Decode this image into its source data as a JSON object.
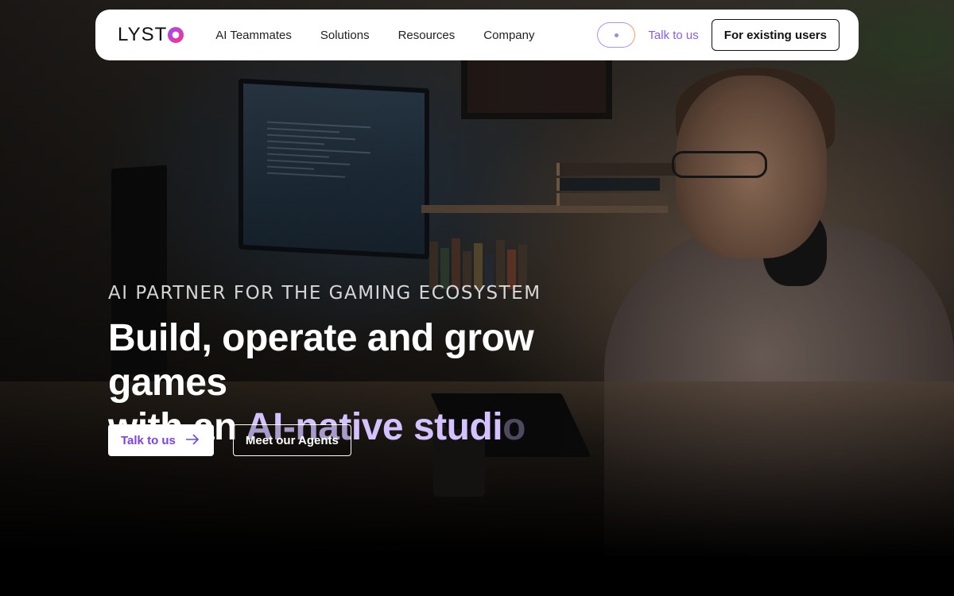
{
  "brand": {
    "logo_text": "LYST",
    "logo_mark": "o"
  },
  "nav": {
    "links": [
      "AI Teammates",
      "Solutions",
      "Resources",
      "Company"
    ],
    "talk_label": "Talk to us",
    "existing_users_label": "For existing users"
  },
  "hero": {
    "eyebrow": "AI PARTNER FOR THE GAMING ECOSYSTEM",
    "headline_line1": "Build, operate and grow games",
    "headline_line2_prefix": "with an ",
    "headline_accent": "AI-native studi",
    "headline_fade": "o",
    "primary_cta": "Talk to us",
    "secondary_cta": "Meet our Agents"
  },
  "colors": {
    "accent": "#8c5bf0",
    "headline_accent": "#d3c2ff",
    "logo_gradient": [
      "#9b4dff",
      "#ff2e8a"
    ]
  },
  "icons": {
    "cta_arrow": "arrow-right-icon"
  }
}
